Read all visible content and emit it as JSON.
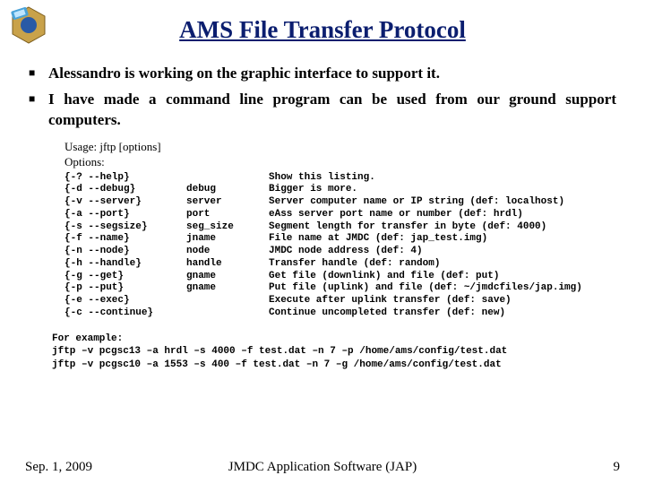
{
  "title": "AMS File Transfer Protocol",
  "bullets": [
    "Alessandro is working on the graphic interface to support it.",
    "I have made a command line program can be used from our ground support computers."
  ],
  "usage_line": "Usage: jftp [options]",
  "options_label": "Options:",
  "options": [
    {
      "flag": "{-? --help}",
      "arg": "",
      "desc": "Show this listing."
    },
    {
      "flag": "{-d --debug}",
      "arg": "debug",
      "desc": "Bigger is more."
    },
    {
      "flag": "{-v --server}",
      "arg": "server",
      "desc": "Server computer name or IP string (def: localhost)"
    },
    {
      "flag": "{-a --port}",
      "arg": "port",
      "desc": "eAss server port name or number (def: hrdl)"
    },
    {
      "flag": "{-s --segsize}",
      "arg": "seg_size",
      "desc": "Segment length for transfer in byte (def: 4000)"
    },
    {
      "flag": "{-f --name}",
      "arg": "jname",
      "desc": "File name at JMDC (def: jap_test.img)"
    },
    {
      "flag": "{-n --node}",
      "arg": "node",
      "desc": "JMDC node address (def: 4)"
    },
    {
      "flag": "{-h --handle}",
      "arg": "handle",
      "desc": "Transfer handle (def: random)"
    },
    {
      "flag": "{-g --get}",
      "arg": "gname",
      "desc": "Get file (downlink) and file (def: put)"
    },
    {
      "flag": "{-p --put}",
      "arg": "gname",
      "desc": "Put file (uplink) and file (def: ~/jmdcfiles/jap.img)"
    },
    {
      "flag": "{-e --exec}",
      "arg": "",
      "desc": "Execute after uplink transfer (def: save)"
    },
    {
      "flag": "{-c --continue}",
      "arg": "",
      "desc": "Continue uncompleted transfer (def: new)"
    }
  ],
  "example_label": "For example:",
  "example_lines": [
    "jftp –v pcgsc13 –a hrdl –s 4000 –f test.dat –n 7 –p /home/ams/config/test.dat",
    "jftp –v pcgsc10 –a 1553 –s 400 –f test.dat –n 7 –g /home/ams/config/test.dat"
  ],
  "footer": {
    "left": "Sep. 1, 2009",
    "mid": "JMDC Application Software (JAP)",
    "right": "9"
  }
}
